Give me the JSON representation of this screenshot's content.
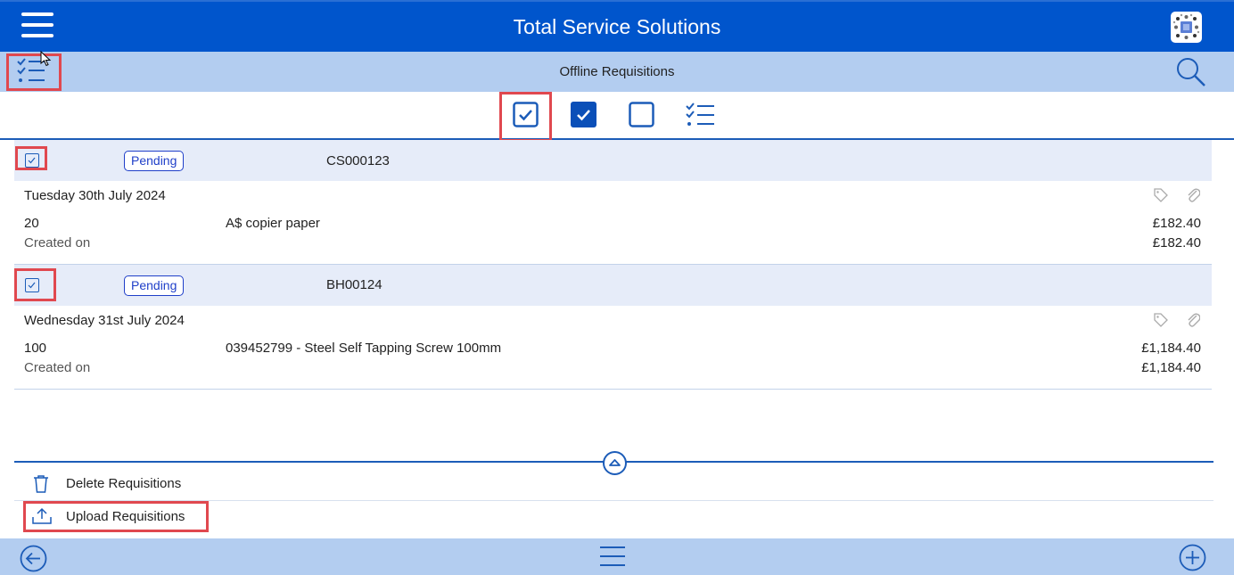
{
  "header": {
    "title": "Total Service Solutions",
    "menu_icon": "hamburger-menu-icon",
    "logo_icon": "app-logo-icon"
  },
  "subheader": {
    "title": "Offline Requisitions",
    "left_icon": "checklist-icon",
    "right_icon": "search-icon"
  },
  "filters": [
    {
      "name": "filter-outlined-checked",
      "icon": "checkbox-outlined-checked-icon"
    },
    {
      "name": "filter-checked",
      "icon": "checkbox-filled-checked-icon"
    },
    {
      "name": "filter-unchecked",
      "icon": "checkbox-empty-icon"
    },
    {
      "name": "filter-all",
      "icon": "checklist-icon"
    }
  ],
  "requisitions": [
    {
      "status": "Pending",
      "reference": "CS000123",
      "date": "Tuesday 30th July 2024",
      "quantity": "20",
      "description": "A$ copier paper",
      "price": "£182.40",
      "total": "£182.40",
      "created_label": "Created on"
    },
    {
      "status": "Pending",
      "reference": "BH00124",
      "date": "Wednesday 31st July 2024",
      "quantity": "100",
      "description": "039452799 - Steel Self Tapping Screw 100mm",
      "price": "£1,184.40",
      "total": "£1,184.40",
      "created_label": "Created on"
    }
  ],
  "actions": {
    "delete_label": "Delete Requisitions",
    "upload_label": "Upload Requisitions"
  },
  "footer": {
    "back_icon": "back-arrow-icon",
    "menu_icon": "hamburger-menu-icon",
    "add_icon": "add-icon"
  },
  "colors": {
    "primary": "#0055cc",
    "light": "#b3cdf0",
    "row_header": "#e6ecf9",
    "highlight": "#e0484f",
    "badge": "#1f3fc9"
  }
}
